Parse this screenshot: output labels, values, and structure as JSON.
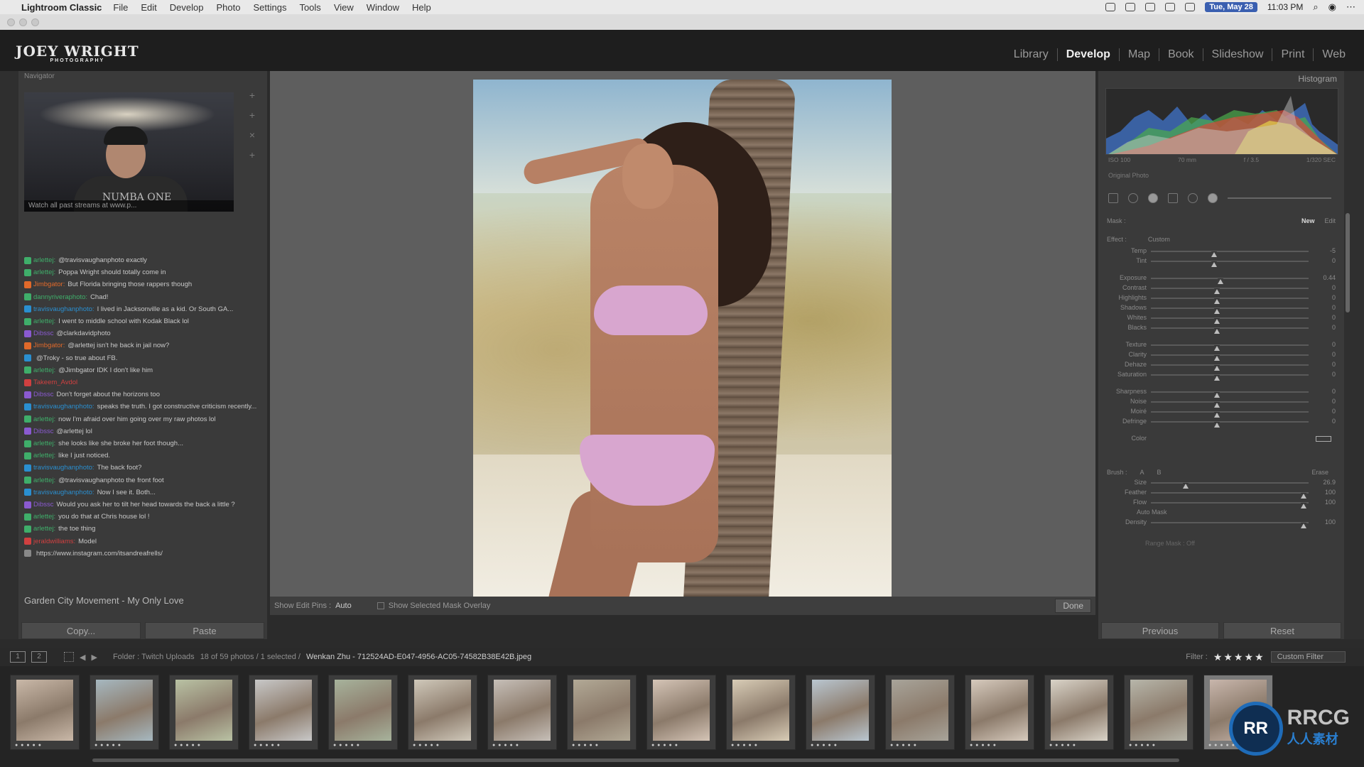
{
  "menubar": {
    "app_name": "Lightroom Classic",
    "items": [
      "File",
      "Edit",
      "Develop",
      "Photo",
      "Settings",
      "Tools",
      "View",
      "Window",
      "Help"
    ],
    "date": "Tue, May 28",
    "time": "11:03 PM"
  },
  "identity_plate": {
    "name": "JOEY WRIGHT",
    "sub": "PHOTOGRAPHY"
  },
  "modules": [
    "Library",
    "Develop",
    "Map",
    "Book",
    "Slideshow",
    "Print",
    "Web"
  ],
  "active_module": "Develop",
  "navigator": {
    "title": "Navigator",
    "caption": "Watch all past streams at www.p...",
    "shirt_text": "NUMBA ONE"
  },
  "chat": [
    {
      "user": "arlettej:",
      "msg": "@travisvaughanphoto exactly",
      "color": "#3fae6a"
    },
    {
      "user": "arlettej:",
      "msg": "Poppa Wright should totally come in",
      "color": "#3fae6a"
    },
    {
      "user": "Jimbgator:",
      "msg": "But Florida bringing those rappers though",
      "color": "#e0692a"
    },
    {
      "user": "dannyriveraphoto:",
      "msg": "Chad!",
      "color": "#3fae6a"
    },
    {
      "user": "travisvaughanphoto:",
      "msg": "I lived in Jacksonville as a kid. Or South GA...",
      "color": "#2a8fd0"
    },
    {
      "user": "arlettej:",
      "msg": "I went to middle school with Kodak Black lol",
      "color": "#3fae6a"
    },
    {
      "user": "Dibssc",
      "msg": "@clarkdavidphoto",
      "color": "#8a5ad0"
    },
    {
      "user": "Jimbgator:",
      "msg": "@arlettej isn't he back in jail now?",
      "color": "#e0692a"
    },
    {
      "user": "",
      "msg": "@Troky - so true about FB.",
      "color": "#2a8fd0"
    },
    {
      "user": "arlettej:",
      "msg": "@Jimbgator IDK I don't like him",
      "color": "#3fae6a"
    },
    {
      "user": "Takeem_Avdol",
      "msg": "",
      "color": "#d04040"
    },
    {
      "user": "Dibssc",
      "msg": "Don't forget about the horizons too",
      "color": "#8a5ad0"
    },
    {
      "user": "travisvaughanphoto:",
      "msg": "speaks the truth. I got constructive criticism recently...",
      "color": "#2a8fd0"
    },
    {
      "user": "arlettej:",
      "msg": "now I'm afraid over him going over my raw photos lol",
      "color": "#3fae6a"
    },
    {
      "user": "Dibssc",
      "msg": "@arlettej lol",
      "color": "#8a5ad0"
    },
    {
      "user": "arlettej:",
      "msg": "she looks like she broke her foot though...",
      "color": "#3fae6a"
    },
    {
      "user": "arlettej:",
      "msg": "like I just noticed.",
      "color": "#3fae6a"
    },
    {
      "user": "travisvaughanphoto:",
      "msg": "The back foot?",
      "color": "#2a8fd0"
    },
    {
      "user": "arlettej:",
      "msg": "@travisvaughanphoto the front foot",
      "color": "#3fae6a"
    },
    {
      "user": "travisvaughanphoto:",
      "msg": "Now I see it. Both...",
      "color": "#2a8fd0"
    },
    {
      "user": "Dibssc",
      "msg": "Would you ask her to tilt her head towards the back a little ?",
      "color": "#8a5ad0"
    },
    {
      "user": "arlettej:",
      "msg": "you do that at Chris house lol !",
      "color": "#3fae6a"
    },
    {
      "user": "arlettej:",
      "msg": "the toe thing",
      "color": "#3fae6a"
    },
    {
      "user": "jeraldwilliams:",
      "msg": "Model",
      "color": "#d04040"
    },
    {
      "user": "",
      "msg": "https://www.instagram.com/itsandreafrells/",
      "color": "#888888"
    }
  ],
  "song": "Garden City Movement - My Only Love",
  "left_buttons": {
    "copy": "Copy...",
    "paste": "Paste"
  },
  "center_toolbar": {
    "edit_pins_label": "Show Edit Pins :",
    "edit_pins_value": "Auto",
    "overlay_label": "Show Selected Mask Overlay",
    "done": "Done"
  },
  "histogram": {
    "title": "Histogram",
    "iso": "ISO 100",
    "focal": "70 mm",
    "aperture": "f / 3.5",
    "shutter": "1/320 SEC",
    "original_photo": "Original Photo"
  },
  "mask": {
    "label": "Mask :",
    "new": "New",
    "edit": "Edit",
    "effect_label": "Effect :",
    "effect_value": "Custom"
  },
  "adjustments": [
    {
      "label": "Temp",
      "value": "-5",
      "pos": 0.4
    },
    {
      "label": "Tint",
      "value": "0",
      "pos": 0.4
    },
    {
      "label": "Exposure",
      "value": "0.44",
      "pos": 0.44
    },
    {
      "label": "Contrast",
      "value": "0",
      "pos": 0.42
    },
    {
      "label": "Highlights",
      "value": "0",
      "pos": 0.42
    },
    {
      "label": "Shadows",
      "value": "0",
      "pos": 0.42
    },
    {
      "label": "Whites",
      "value": "0",
      "pos": 0.42
    },
    {
      "label": "Blacks",
      "value": "0",
      "pos": 0.42
    },
    {
      "label": "Texture",
      "value": "0",
      "pos": 0.42
    },
    {
      "label": "Clarity",
      "value": "0",
      "pos": 0.42
    },
    {
      "label": "Dehaze",
      "value": "0",
      "pos": 0.42
    },
    {
      "label": "Saturation",
      "value": "0",
      "pos": 0.42
    },
    {
      "label": "Sharpness",
      "value": "0",
      "pos": 0.42
    },
    {
      "label": "Noise",
      "value": "0",
      "pos": 0.42
    },
    {
      "label": "Moiré",
      "value": "0",
      "pos": 0.42
    },
    {
      "label": "Defringe",
      "value": "0",
      "pos": 0.42
    },
    {
      "label": "Color",
      "value": "",
      "pos": -1
    }
  ],
  "brush": {
    "label": "Brush :",
    "a": "A",
    "b": "B",
    "erase": "Erase",
    "params": [
      {
        "label": "Size",
        "value": "26.9",
        "pos": 0.22
      },
      {
        "label": "Feather",
        "value": "100",
        "pos": 0.97
      },
      {
        "label": "Flow",
        "value": "100",
        "pos": 0.97
      }
    ],
    "auto_mask": "Auto Mask",
    "density": {
      "label": "Density",
      "value": "100",
      "pos": 0.97
    },
    "range_mask": "Range Mask : Off"
  },
  "right_buttons": {
    "previous": "Previous",
    "reset": "Reset"
  },
  "filmstrip": {
    "screen1": "1",
    "screen2": "2",
    "folder": "Folder : Twitch Uploads",
    "count": "18 of 59 photos / 1 selected /",
    "filename": "Wenkan Zhu - 712524AD-E047-4956-AC05-74582B38E42B.jpeg",
    "filter_label": "Filter :",
    "stars": "★★★★★",
    "custom_filter": "Custom Filter",
    "thumbs": [
      {
        "tone": "#c9b8a8",
        "selected": false
      },
      {
        "tone": "#a6b8c0",
        "selected": false
      },
      {
        "tone": "#b9c2a4",
        "selected": false
      },
      {
        "tone": "#c8c8c8",
        "selected": false
      },
      {
        "tone": "#a7b39c",
        "selected": false
      },
      {
        "tone": "#cfc8ba",
        "selected": false
      },
      {
        "tone": "#c6bfb8",
        "selected": false
      },
      {
        "tone": "#b2a996",
        "selected": false
      },
      {
        "tone": "#d4c4b6",
        "selected": false
      },
      {
        "tone": "#d8ccb6",
        "selected": false
      },
      {
        "tone": "#b9c6d0",
        "selected": false
      },
      {
        "tone": "#a8a49a",
        "selected": false
      },
      {
        "tone": "#d6cabd",
        "selected": false
      },
      {
        "tone": "#d9d3c8",
        "selected": false
      },
      {
        "tone": "#b7b6aa",
        "selected": false
      },
      {
        "tone": "#c8b6ac",
        "selected": true
      }
    ]
  },
  "watermark": {
    "badge": "RR",
    "brand": "RRCG",
    "sub": "人人素材"
  }
}
